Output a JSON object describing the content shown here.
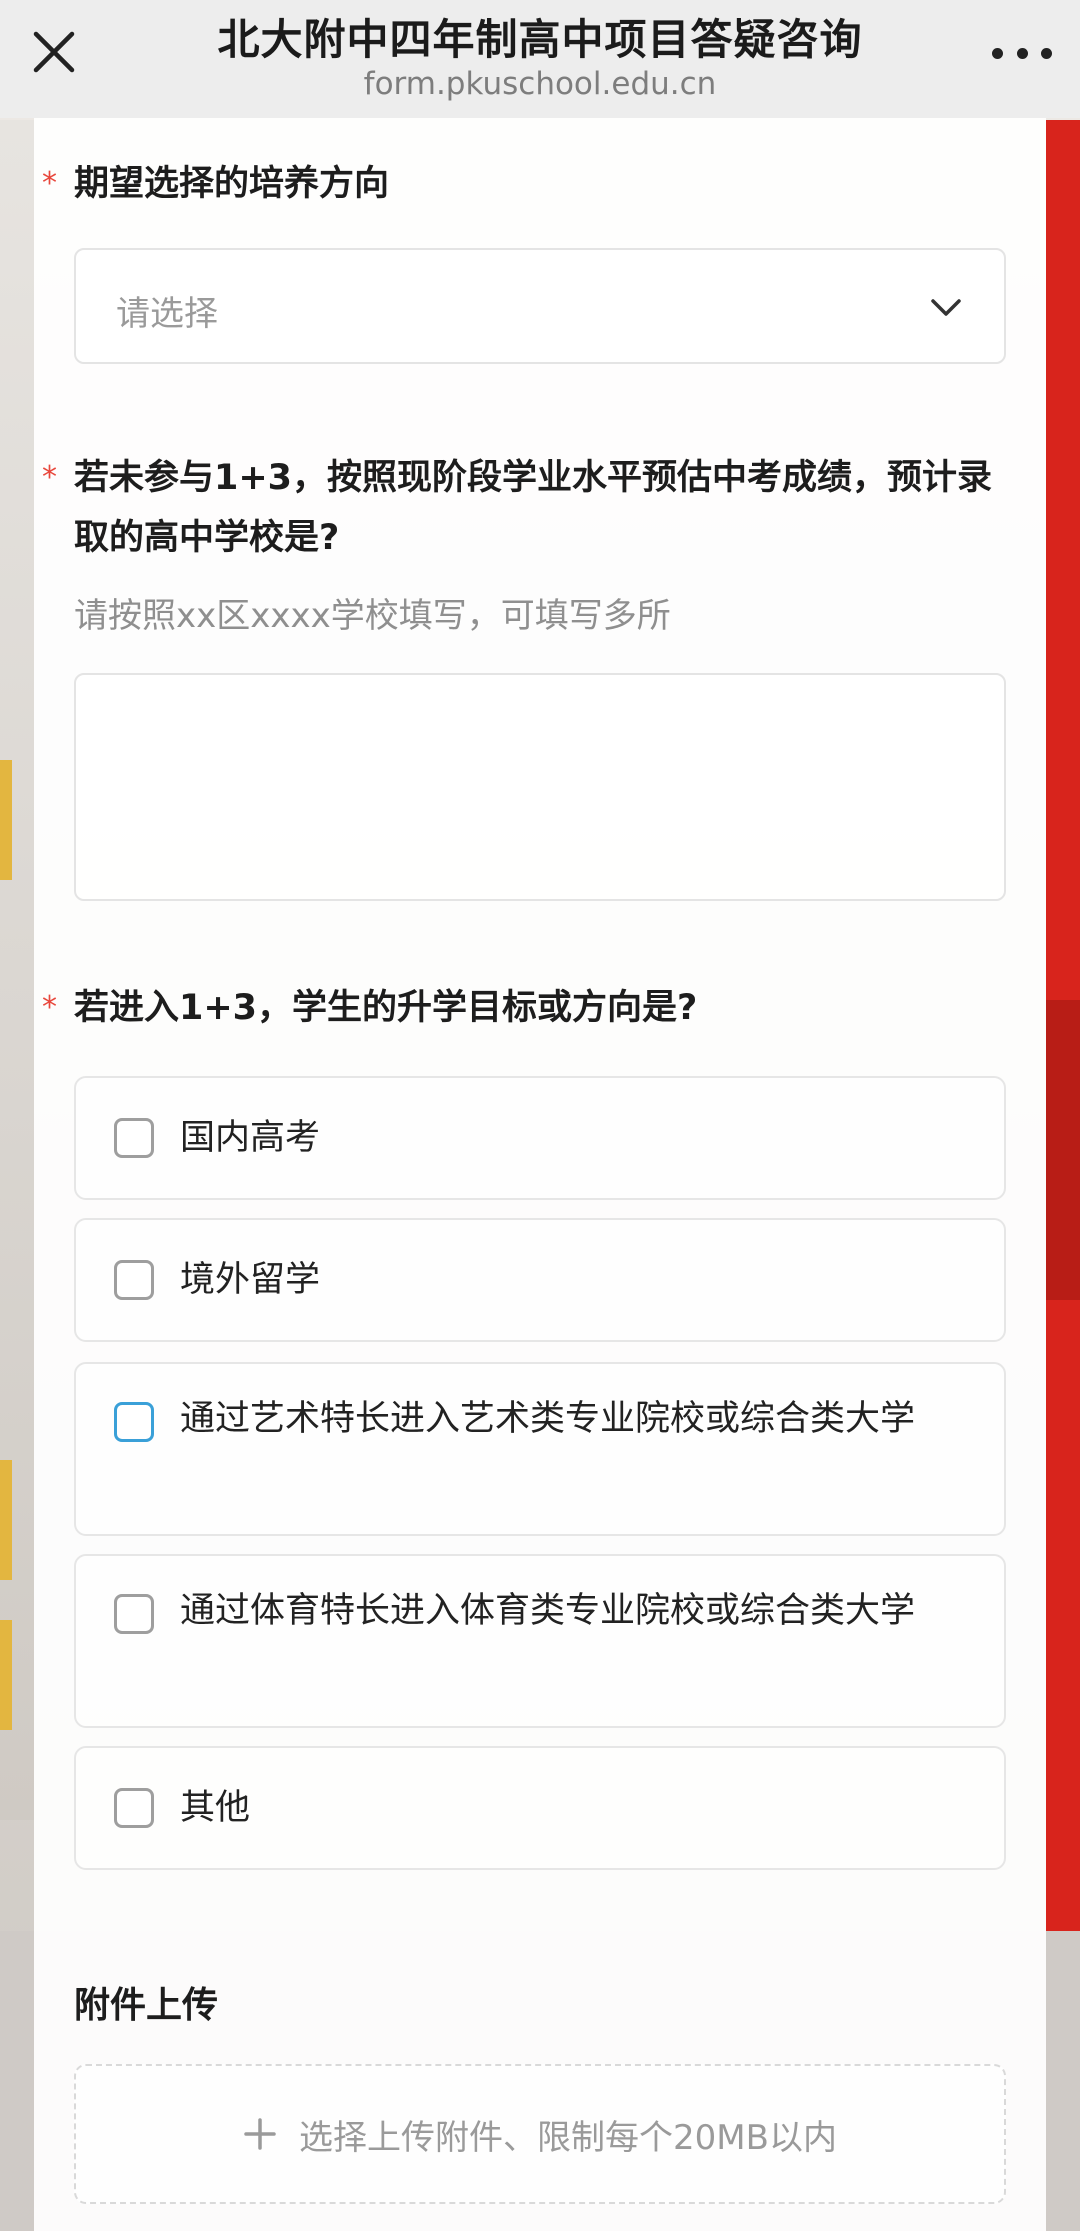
{
  "header": {
    "title": "北大附中四年制高中项目答疑咨询",
    "domain": "form.pkuschool.edu.cn"
  },
  "questions": {
    "q1": {
      "required_mark": "*",
      "label": "期望选择的培养方向",
      "select_placeholder": "请选择"
    },
    "q2": {
      "required_mark": "*",
      "label": "若未参与1+3，按照现阶段学业水平预估中考成绩，预计录取的高中学校是?",
      "hint": "请按照xx区xxxx学校填写，可填写多所",
      "value": ""
    },
    "q3": {
      "required_mark": "*",
      "label": "若进入1+3，学生的升学目标或方向是?",
      "options": [
        {
          "label": "国内高考",
          "checked": false
        },
        {
          "label": "境外留学",
          "checked": false
        },
        {
          "label": "通过艺术特长进入艺术类专业院校或综合类大学",
          "checked": false
        },
        {
          "label": "通过体育特长进入体育类专业院校或综合类大学",
          "checked": false
        },
        {
          "label": "其他",
          "checked": false
        }
      ]
    }
  },
  "attachments": {
    "title": "附件上传",
    "upload_label": "选择上传附件、限制每个20MB以内"
  },
  "colors": {
    "required": "#e8473c",
    "focus_checkbox": "#3aa0d8",
    "background_red": "#d8241c"
  }
}
